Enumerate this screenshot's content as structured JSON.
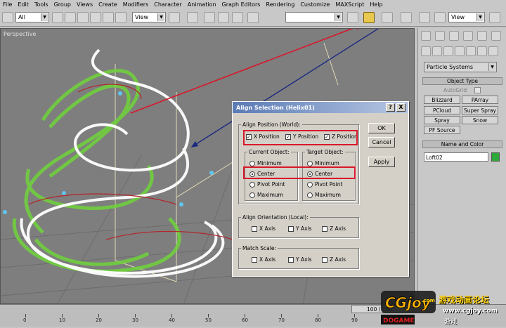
{
  "menu": [
    "File",
    "Edit",
    "Tools",
    "Group",
    "Views",
    "Create",
    "Modifiers",
    "Character",
    "Animation",
    "Graph Editors",
    "Rendering",
    "Customize",
    "MAXScript",
    "Help"
  ],
  "toolbar": {
    "filter_value": "All",
    "refcoord_value": "View",
    "right_view_value": "View"
  },
  "viewport": {
    "label": "Perspective"
  },
  "command_panel": {
    "category_value": "Particle Systems",
    "object_type_header": "Object Type",
    "autogrid_label": "AutoGrid",
    "buttons": [
      "Blizzard",
      "PArray",
      "PCloud",
      "Super Spray",
      "Spray",
      "Snow",
      "PF Source"
    ],
    "name_color_header": "Name and Color",
    "name_value": "Loft02",
    "swatch_color": "#2fa83a"
  },
  "dialog": {
    "title": "Align Selection (Helix01)",
    "help_glyph": "?",
    "close_glyph": "X",
    "position_group": "Align Position (World):",
    "x_pos": "X Position",
    "y_pos": "Y Position",
    "z_pos": "Z Position",
    "current_group": "Current Object:",
    "target_group": "Target Object:",
    "options": [
      "Minimum",
      "Center",
      "Pivot Point",
      "Maximum"
    ],
    "orientation_group": "Align Orientation (Local):",
    "scale_group": "Match Scale:",
    "x_axis": "X Axis",
    "y_axis": "Y Axis",
    "z_axis": "Z Axis",
    "ok": "OK",
    "cancel": "Cancel",
    "apply": "Apply",
    "highlight_color": "#d9172a"
  },
  "timeline": {
    "slider_label": "100 / 100",
    "ticks": [
      "0",
      "10",
      "20",
      "30",
      "40",
      "50",
      "60",
      "70",
      "80",
      "90"
    ]
  },
  "watermark": {
    "logo": "CGjoy",
    "sub_logo": "DOGAME",
    "dot_com": ".com",
    "site_name": "游戏动画论坛",
    "url": "www.cgjoy.com",
    "cn_tag": "游戏"
  }
}
